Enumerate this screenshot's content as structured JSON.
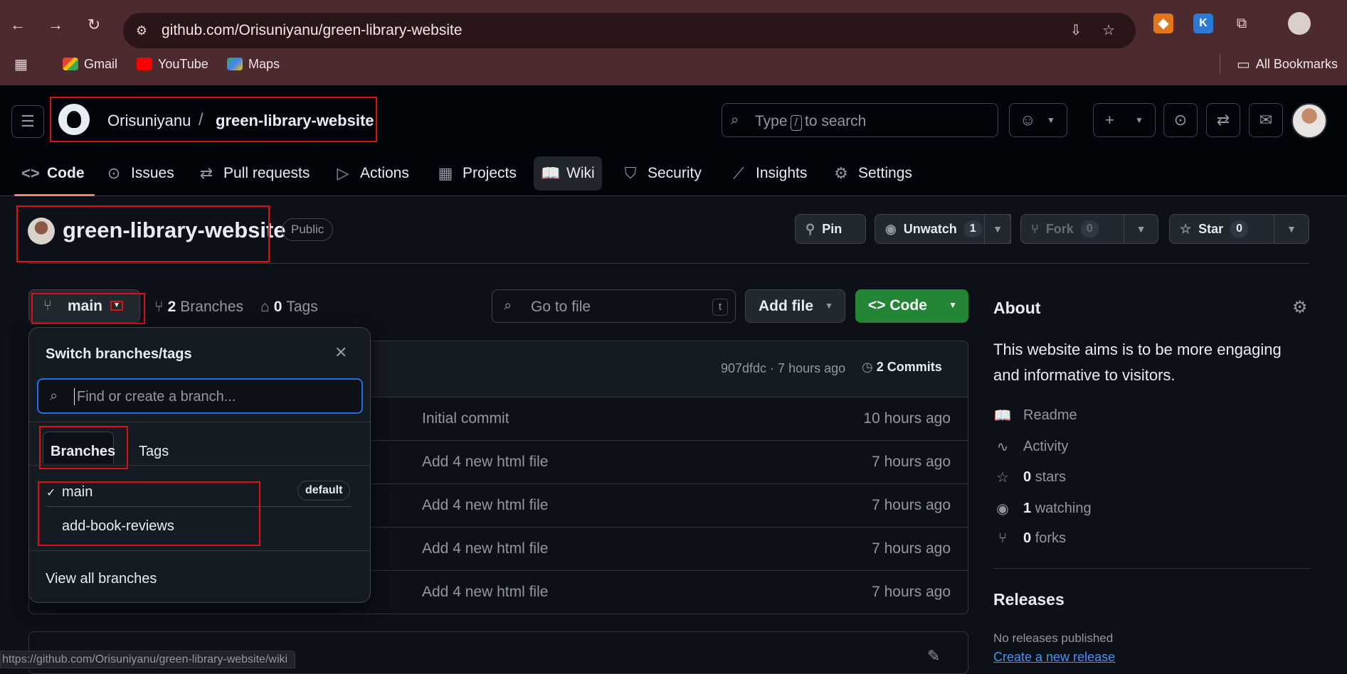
{
  "browser": {
    "url": "github.com/Orisuniyanu/green-library-website",
    "bookmarks": [
      "Gmail",
      "YouTube",
      "Maps"
    ],
    "all_bookmarks": "All Bookmarks",
    "status_url": "https://github.com/Orisuniyanu/green-library-website/wiki"
  },
  "header": {
    "owner": "Orisuniyanu",
    "separator": "/",
    "repo": "green-library-website",
    "search_before": "Type",
    "search_key": "/",
    "search_after": "to search"
  },
  "tabs": [
    "Code",
    "Issues",
    "Pull requests",
    "Actions",
    "Projects",
    "Wiki",
    "Security",
    "Insights",
    "Settings"
  ],
  "repo": {
    "name": "green-library-website",
    "visibility": "Public",
    "pin": "Pin",
    "unwatch": "Unwatch",
    "watch_count": "1",
    "fork": "Fork",
    "fork_count": "0",
    "star": "Star",
    "star_count": "0"
  },
  "toolbar": {
    "branch": "main",
    "branches_count": "2",
    "branches_label": "Branches",
    "tags_count": "0",
    "tags_label": "Tags",
    "go_to_file": "Go to file",
    "go_to_file_key": "t",
    "add_file": "Add file",
    "code": "Code"
  },
  "commit": {
    "sha_time": "907dfdc · 7 hours ago",
    "commits": "2 Commits"
  },
  "files": [
    {
      "message": "Initial commit",
      "time": "10 hours ago"
    },
    {
      "message": "Add 4 new html file",
      "time": "7 hours ago"
    },
    {
      "message": "Add 4 new html file",
      "time": "7 hours ago"
    },
    {
      "message": "Add 4 new html file",
      "time": "7 hours ago"
    },
    {
      "message": "Add 4 new html file",
      "time": "7 hours ago"
    }
  ],
  "dropdown": {
    "title": "Switch branches/tags",
    "placeholder": "Find or create a branch...",
    "tab_branches": "Branches",
    "tab_tags": "Tags",
    "branches": [
      {
        "name": "main",
        "badge": "default",
        "selected": true
      },
      {
        "name": "add-book-reviews"
      }
    ],
    "footer": "View all branches"
  },
  "about": {
    "title": "About",
    "description": "This website aims is to be more engaging and informative to visitors.",
    "readme": "Readme",
    "activity": "Activity",
    "stars_count": "0",
    "stars_label": "stars",
    "watching_count": "1",
    "watching_label": "watching",
    "forks_count": "0",
    "forks_label": "forks",
    "releases_title": "Releases",
    "no_releases": "No releases published",
    "create_release": "Create a new release"
  },
  "colors": {
    "chrome": "#4d2a2e",
    "background": "#0d1117",
    "accent_green": "#238636",
    "link_blue": "#4493f8",
    "annotation_red": "#dd1111"
  }
}
